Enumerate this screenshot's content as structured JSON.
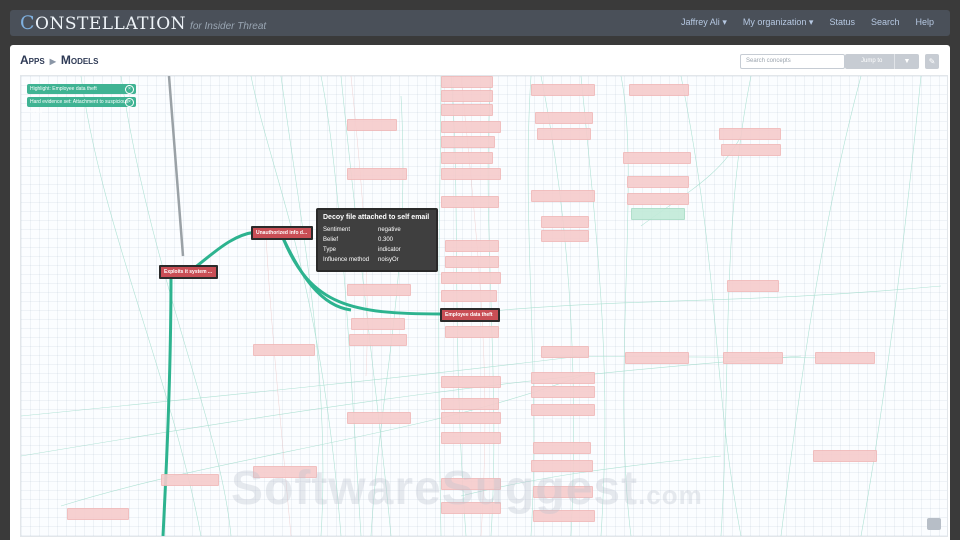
{
  "brand": {
    "logo_prefix": "C",
    "logo_rest": "ONSTELLATION",
    "subtitle": "for Insider Threat"
  },
  "nav": {
    "user": "Jaffrey Ali",
    "org": "My organization",
    "status": "Status",
    "search": "Search",
    "help": "Help"
  },
  "breadcrumb": {
    "apps": "Apps",
    "models": "Models"
  },
  "search": {
    "placeholder": "Search concepts"
  },
  "jump": {
    "label": "Jump to"
  },
  "highlights": [
    "Highlight: Employee data theft",
    "Hard evidence set: Attachment to suspicious email"
  ],
  "key_nodes": [
    "Exploits it system ...",
    "Unauthorized info d...",
    "Employee data theft"
  ],
  "tooltip": {
    "title": "Decoy file attached to self email",
    "rows": [
      {
        "label": "Sentiment",
        "value": "negative"
      },
      {
        "label": "Belief",
        "value": "0.300"
      },
      {
        "label": "Type",
        "value": "indicator"
      },
      {
        "label": "Influence method",
        "value": "noisyOr"
      }
    ]
  },
  "watermark": {
    "main": "SoftwareSuggest",
    "suffix": ".com"
  },
  "colors": {
    "accent": "#3fb393",
    "key_node": "#c94e55",
    "node_faded": "#f6cccc",
    "topbar": "#4a5059"
  }
}
